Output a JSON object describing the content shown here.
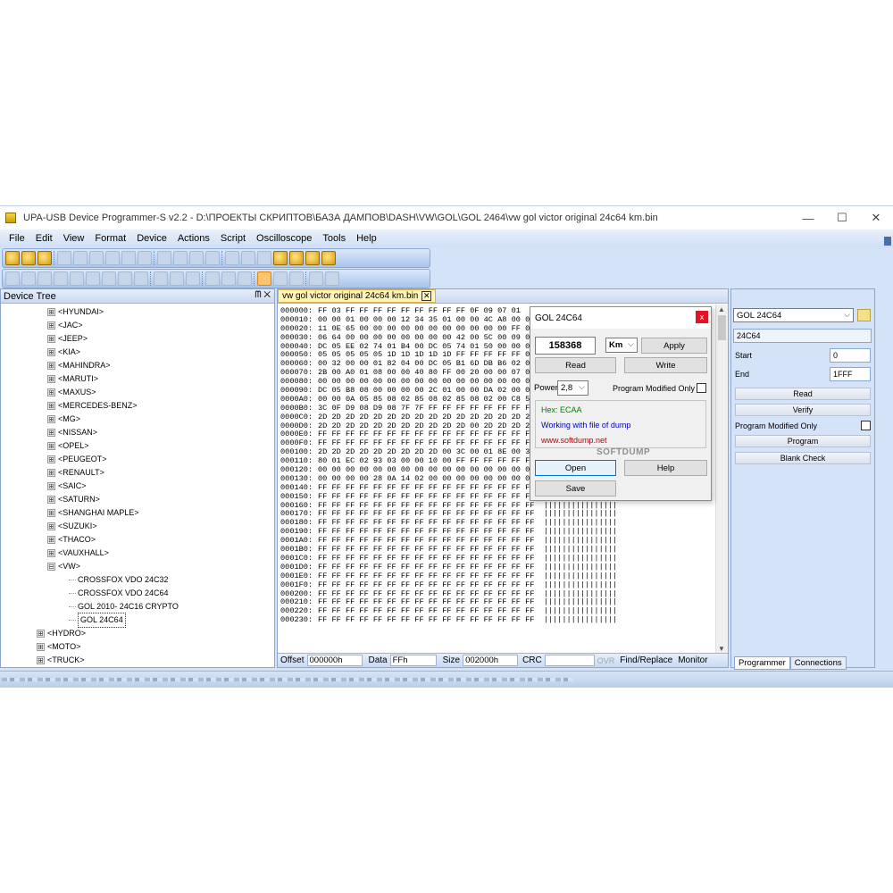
{
  "window": {
    "title": "UPA-USB Device Programmer-S v2.2 - D:\\ПРОЕКТЫ СКРИПТОВ\\БАЗА ДАМПОВ\\DASH\\VW\\GOL\\GOL 2464\\vw gol victor original 24c64 km.bin",
    "minimize": "—",
    "maximize": "☐",
    "close": "✕"
  },
  "menu": [
    "File",
    "Edit",
    "View",
    "Format",
    "Device",
    "Actions",
    "Script",
    "Oscilloscope",
    "Tools",
    "Help"
  ],
  "device_tree": {
    "header": "Device Tree",
    "header_controls": "ᗰ ✕",
    "items": [
      {
        "label": "<HYUNDAI>",
        "level": 1,
        "expander": "⊞"
      },
      {
        "label": "<JAC>",
        "level": 1,
        "expander": "⊞"
      },
      {
        "label": "<JEEP>",
        "level": 1,
        "expander": "⊞"
      },
      {
        "label": "<KIA>",
        "level": 1,
        "expander": "⊞"
      },
      {
        "label": "<MAHINDRA>",
        "level": 1,
        "expander": "⊞"
      },
      {
        "label": "<MARUTI>",
        "level": 1,
        "expander": "⊞"
      },
      {
        "label": "<MAXUS>",
        "level": 1,
        "expander": "⊞"
      },
      {
        "label": "<MERCEDES-BENZ>",
        "level": 1,
        "expander": "⊞"
      },
      {
        "label": "<MG>",
        "level": 1,
        "expander": "⊞"
      },
      {
        "label": "<NISSAN>",
        "level": 1,
        "expander": "⊞"
      },
      {
        "label": "<OPEL>",
        "level": 1,
        "expander": "⊞"
      },
      {
        "label": "<PEUGEOT>",
        "level": 1,
        "expander": "⊞"
      },
      {
        "label": "<RENAULT>",
        "level": 1,
        "expander": "⊞"
      },
      {
        "label": "<SAIC>",
        "level": 1,
        "expander": "⊞"
      },
      {
        "label": "<SATURN>",
        "level": 1,
        "expander": "⊞"
      },
      {
        "label": "<SHANGHAI MAPLE>",
        "level": 1,
        "expander": "⊞"
      },
      {
        "label": "<SUZUKI>",
        "level": 1,
        "expander": "⊞"
      },
      {
        "label": "<THACO>",
        "level": 1,
        "expander": "⊞"
      },
      {
        "label": "<VAUXHALL>",
        "level": 1,
        "expander": "⊞"
      },
      {
        "label": "<VW>",
        "level": 1,
        "expander": "⊟"
      },
      {
        "label": "CROSSFOX VDO 24C32",
        "level": 2,
        "expander": ""
      },
      {
        "label": "CROSSFOX VDO 24C64",
        "level": 2,
        "expander": ""
      },
      {
        "label": "GOL 2010- 24C16 CRYPTO",
        "level": 2,
        "expander": ""
      },
      {
        "label": "GOL 24C64",
        "level": 2,
        "expander": "",
        "selected": true
      },
      {
        "label": "<HYDRO>",
        "level": 0,
        "expander": "⊞"
      },
      {
        "label": "<MOTO>",
        "level": 0,
        "expander": "⊞"
      },
      {
        "label": "<TRUCK>",
        "level": 0,
        "expander": "⊞"
      },
      {
        "label": "<ECU>",
        "level": -1,
        "expander": "⊞"
      }
    ]
  },
  "hex_editor": {
    "tab_label": "vw gol victor original 24c64 km.bin",
    "tab_close": "✕",
    "rows": [
      {
        "addr": "000000:",
        "bytes": "FF 03 FF FF FF FF FF FF FF FF FF 0F 09 07 01"
      },
      {
        "addr": "000010:",
        "bytes": "00 00 01 00 00 00 12 34 35 01 00 00 4C A8 00 09"
      },
      {
        "addr": "000020:",
        "bytes": "11 0E 65 00 00 00 00 00 00 00 00 00 00 00 FF 00"
      },
      {
        "addr": "000030:",
        "bytes": "06 64 00 00 00 00 00 00 00 00 42 00 5C 00 09 05"
      },
      {
        "addr": "000040:",
        "bytes": "DC 05 EE 02 74 01 B4 00 DC 05 74 01 50 00 00 01"
      },
      {
        "addr": "000050:",
        "bytes": "05 05 05 05 05 1D 1D 1D 1D 1D FF FF FF FF FF 01"
      },
      {
        "addr": "000060:",
        "bytes": "00 32 00 00 01 82 04 00 DC 05 B1 6D DB B6 02 00"
      },
      {
        "addr": "000070:",
        "bytes": "2B 00 A0 01 08 00 00 40 80 FF 00 20 00 00 07 0A"
      },
      {
        "addr": "000080:",
        "bytes": "00 00 00 00 00 00 00 00 00 00 00 00 00 00 00 00"
      },
      {
        "addr": "000090:",
        "bytes": "DC 05 B8 08 00 00 00 00 2C 01 00 00 DA 02 00 00"
      },
      {
        "addr": "0000A0:",
        "bytes": "00 00 0A 05 85 08 02 85 08 02 85 08 02 00 C8 52"
      },
      {
        "addr": "0000B0:",
        "bytes": "3C 0F D9 08 D9 08 7F 7F FF FF FF FF FF FF FF FF"
      },
      {
        "addr": "0000C0:",
        "bytes": "2D 2D 2D 2D 2D 2D 2D 2D 2D 2D 2D 2D 2D 2D 2D 2D"
      },
      {
        "addr": "0000D0:",
        "bytes": "2D 2D 2D 2D 2D 2D 2D 2D 2D 2D 2D 00 2D 2D 2D 2D"
      },
      {
        "addr": "0000E0:",
        "bytes": "FF FF FF FF FF FF FF FF FF FF FF FF FF FF FF FF"
      },
      {
        "addr": "0000F0:",
        "bytes": "FF FF FF FF FF FF FF FF FF FF FF FF FF FF FF FF"
      },
      {
        "addr": "000100:",
        "bytes": "2D 2D 2D 2D 2D 2D 2D 2D 2D 00 3C 00 01 8E 00 3A 01"
      },
      {
        "addr": "000110:",
        "bytes": "80 01 EC 02 93 03 00 00 10 00 FF FF FF FF FF FF"
      },
      {
        "addr": "000120:",
        "bytes": "00 00 00 00 00 00 00 00 00 00 00 00 00 00 00 00"
      },
      {
        "addr": "000130:",
        "bytes": "00 00 00 00 28 0A 14 02 00 00 00 00 00 00 00 00"
      },
      {
        "addr": "000140:",
        "bytes": "FF FF FF FF FF FF FF FF FF FF FF FF FF FF FF FF  ||||||||||||||||"
      },
      {
        "addr": "000150:",
        "bytes": "FF FF FF FF FF FF FF FF FF FF FF FF FF FF FF FF  ||||||||||||||||"
      },
      {
        "addr": "000160:",
        "bytes": "FF FF FF FF FF FF FF FF FF FF FF FF FF FF FF FF  ||||||||||||||||"
      },
      {
        "addr": "000170:",
        "bytes": "FF FF FF FF FF FF FF FF FF FF FF FF FF FF FF FF  ||||||||||||||||"
      },
      {
        "addr": "000180:",
        "bytes": "FF FF FF FF FF FF FF FF FF FF FF FF FF FF FF FF  ||||||||||||||||"
      },
      {
        "addr": "000190:",
        "bytes": "FF FF FF FF FF FF FF FF FF FF FF FF FF FF FF FF  ||||||||||||||||"
      },
      {
        "addr": "0001A0:",
        "bytes": "FF FF FF FF FF FF FF FF FF FF FF FF FF FF FF FF  ||||||||||||||||"
      },
      {
        "addr": "0001B0:",
        "bytes": "FF FF FF FF FF FF FF FF FF FF FF FF FF FF FF FF  ||||||||||||||||"
      },
      {
        "addr": "0001C0:",
        "bytes": "FF FF FF FF FF FF FF FF FF FF FF FF FF FF FF FF  ||||||||||||||||"
      },
      {
        "addr": "0001D0:",
        "bytes": "FF FF FF FF FF FF FF FF FF FF FF FF FF FF FF FF  ||||||||||||||||"
      },
      {
        "addr": "0001E0:",
        "bytes": "FF FF FF FF FF FF FF FF FF FF FF FF FF FF FF FF  ||||||||||||||||"
      },
      {
        "addr": "0001F0:",
        "bytes": "FF FF FF FF FF FF FF FF FF FF FF FF FF FF FF FF  ||||||||||||||||"
      },
      {
        "addr": "000200:",
        "bytes": "FF FF FF FF FF FF FF FF FF FF FF FF FF FF FF FF  ||||||||||||||||"
      },
      {
        "addr": "000210:",
        "bytes": "FF FF FF FF FF FF FF FF FF FF FF FF FF FF FF FF  ||||||||||||||||"
      },
      {
        "addr": "000220:",
        "bytes": "FF FF FF FF FF FF FF FF FF FF FF FF FF FF FF FF  ||||||||||||||||"
      },
      {
        "addr": "000230:",
        "bytes": "FF FF FF FF FF FF FF FF FF FF FF FF FF FF FF FF  ||||||||||||||||"
      }
    ],
    "status": {
      "offset_label": "Offset",
      "offset_value": "000000h",
      "data_label": "Data",
      "data_value": "FFh",
      "size_label": "Size",
      "size_value": "002000h",
      "crc_label": "CRC",
      "crc_value": "",
      "ovr_label": "OVR",
      "find_replace": "Find/Replace",
      "monitor": "Monitor"
    }
  },
  "dialog": {
    "title": "GOL 24C64",
    "close": "x",
    "km_value": "158368",
    "unit_value": "Km",
    "apply": "Apply",
    "read": "Read",
    "write": "Write",
    "power_label": "Power",
    "power_value": "2,8",
    "program_modified_label": "Program Modified Only",
    "hex_line": "Hex: ECAA",
    "status_line": "Working with file of dump",
    "site": "www.softdump.net",
    "brand": "SOFTDUMP",
    "open": "Open",
    "help": "Help",
    "save": "Save",
    "colors": {
      "hex": "#008000",
      "status": "#0000c0",
      "site": "#c00000",
      "brand": "#909090"
    }
  },
  "right_panel": {
    "device_select": "GOL 24C64",
    "chip": "24C64",
    "start_label": "Start",
    "start_value": "0",
    "end_label": "End",
    "end_value": "1FFF",
    "read": "Read",
    "verify": "Verify",
    "program_modified_label": "Program Modified Only",
    "program": "Program",
    "blank_check": "Blank Check",
    "tabs": [
      "Programmer",
      "Connections"
    ]
  }
}
